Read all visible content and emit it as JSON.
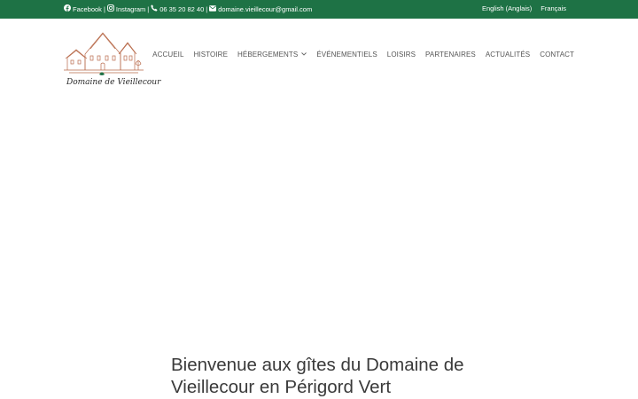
{
  "topbar": {
    "facebook_label": "Facebook",
    "instagram_label": "Instagram",
    "phone": "06 35 20 82 40",
    "email": "domaine.vieillecour@gmail.com",
    "separator": "|",
    "lang_english": "English (Anglais)",
    "lang_french": "Français",
    "background_color": "#1e7245"
  },
  "logo": {
    "text": "Domaine de Vieillecour",
    "icon": "chateau-logo-icon"
  },
  "nav": {
    "items": [
      {
        "label": "ACCUEIL"
      },
      {
        "label": "HISTOIRE"
      },
      {
        "label": "HÉBERGEMENTS"
      },
      {
        "label": "ÉVÉNEMENTIELS"
      },
      {
        "label": "LOISIRS"
      },
      {
        "label": "PARTENAIRES"
      },
      {
        "label": "ACTUALITÉS"
      },
      {
        "label": "CONTACT"
      }
    ]
  },
  "main": {
    "welcome_heading_line1": "Bienvenue aux gîtes du Domaine de",
    "welcome_heading_line2": "Vieillecour en Périgord Vert"
  }
}
